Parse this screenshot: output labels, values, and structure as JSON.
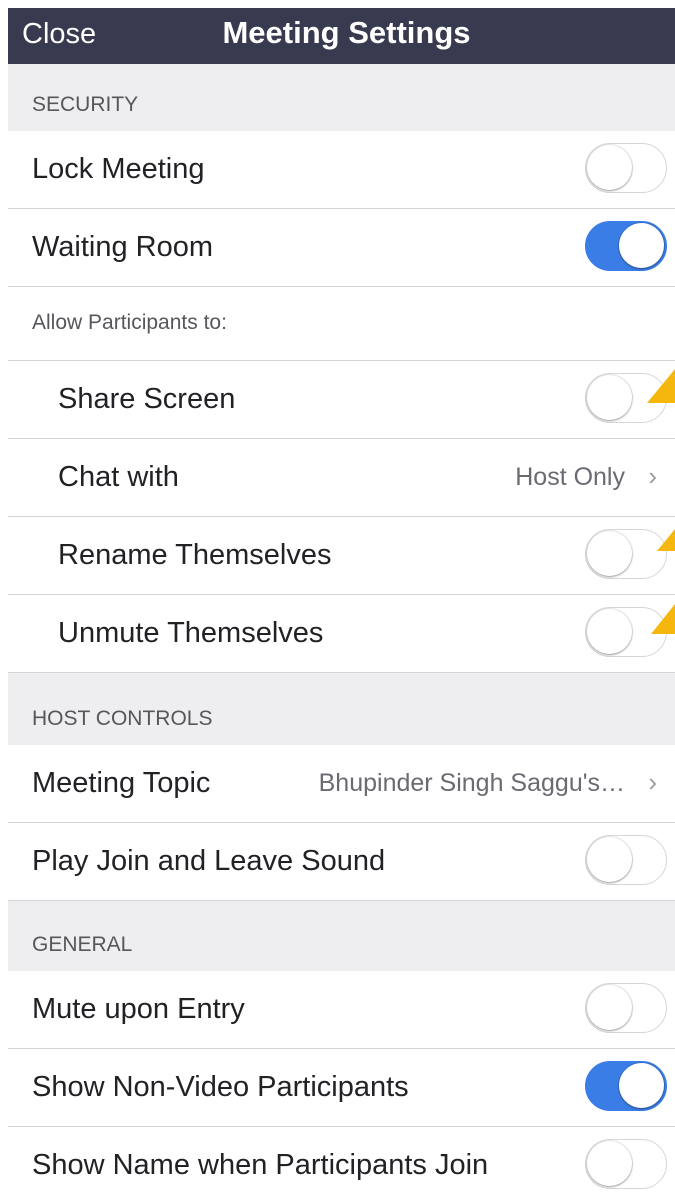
{
  "header": {
    "close_label": "Close",
    "title": "Meeting Settings"
  },
  "colors": {
    "header_bg": "#383b4f",
    "toggle_on": "#3b7de6",
    "flag": "#f5b70e"
  },
  "sections": {
    "security": "SECURITY",
    "host_controls": "HOST CONTROLS",
    "general": "GENERAL"
  },
  "security": {
    "lock_meeting": {
      "label": "Lock Meeting",
      "on": false
    },
    "waiting_room": {
      "label": "Waiting Room",
      "on": true
    },
    "allow_label": "Allow Participants to:",
    "share_screen": {
      "label": "Share Screen",
      "on": false
    },
    "chat_with": {
      "label": "Chat with",
      "value": "Host Only"
    },
    "rename_themselves": {
      "label": "Rename Themselves",
      "on": false
    },
    "unmute_themselves": {
      "label": "Unmute Themselves",
      "on": false
    }
  },
  "host_controls": {
    "meeting_topic": {
      "label": "Meeting Topic",
      "value": "Bhupinder Singh Saggu's…"
    },
    "play_join_leave_sound": {
      "label": "Play Join and Leave Sound",
      "on": false
    }
  },
  "general": {
    "mute_upon_entry": {
      "label": "Mute upon Entry",
      "on": false
    },
    "show_non_video": {
      "label": "Show Non-Video Participants",
      "on": true
    },
    "show_name_join": {
      "label": "Show Name when Participants Join",
      "on": false
    }
  },
  "chevron_glyph": "›"
}
